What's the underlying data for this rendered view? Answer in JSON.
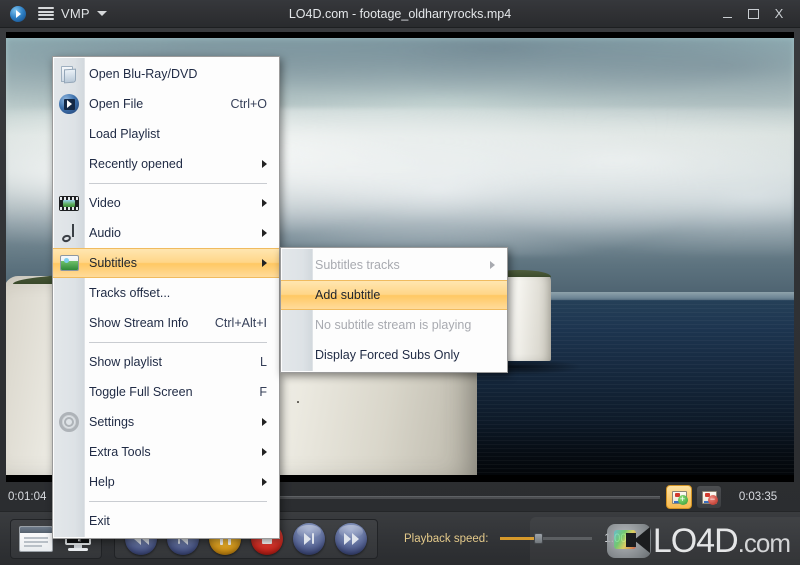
{
  "titlebar": {
    "app_name": "VMP",
    "title": "LO4D.com - footage_oldharryrocks.mp4",
    "minimize": "_",
    "maximize": "",
    "close": "X"
  },
  "menu": {
    "items": [
      {
        "label": "Open Blu-Ray/DVD",
        "accel": "",
        "icon": "folder-icon",
        "submenu": false,
        "disabled": false,
        "selected": false
      },
      {
        "label": "Open File",
        "accel": "Ctrl+O",
        "icon": "disc-play-icon",
        "submenu": false,
        "disabled": false,
        "selected": false
      },
      {
        "label": "Load Playlist",
        "accel": "",
        "icon": "",
        "submenu": false,
        "disabled": false,
        "selected": false
      },
      {
        "label": "Recently opened",
        "accel": "",
        "icon": "",
        "submenu": true,
        "disabled": false,
        "selected": false
      },
      {
        "separator": true
      },
      {
        "label": "Video",
        "accel": "",
        "icon": "film-icon",
        "submenu": true,
        "disabled": false,
        "selected": false
      },
      {
        "label": "Audio",
        "accel": "",
        "icon": "music-note-icon",
        "submenu": true,
        "disabled": false,
        "selected": false
      },
      {
        "label": "Subtitles",
        "accel": "",
        "icon": "subtitles-icon",
        "submenu": true,
        "disabled": false,
        "selected": true
      },
      {
        "label": "Tracks offset...",
        "accel": "",
        "icon": "",
        "submenu": false,
        "disabled": false,
        "selected": false
      },
      {
        "label": "Show Stream Info",
        "accel": "Ctrl+Alt+I",
        "icon": "",
        "submenu": false,
        "disabled": false,
        "selected": false
      },
      {
        "separator": true
      },
      {
        "label": "Show playlist",
        "accel": "L",
        "icon": "",
        "submenu": false,
        "disabled": false,
        "selected": false
      },
      {
        "label": "Toggle Full Screen",
        "accel": "F",
        "icon": "",
        "submenu": false,
        "disabled": false,
        "selected": false
      },
      {
        "label": "Settings",
        "accel": "",
        "icon": "gear-icon",
        "submenu": true,
        "disabled": false,
        "selected": false
      },
      {
        "label": "Extra Tools",
        "accel": "",
        "icon": "",
        "submenu": true,
        "disabled": false,
        "selected": false
      },
      {
        "label": "Help",
        "accel": "",
        "icon": "",
        "submenu": true,
        "disabled": false,
        "selected": false
      },
      {
        "separator": true
      },
      {
        "label": "Exit",
        "accel": "",
        "icon": "",
        "submenu": false,
        "disabled": false,
        "selected": false
      }
    ]
  },
  "submenu": {
    "items": [
      {
        "label": "Subtitles tracks",
        "submenu": true,
        "disabled": true,
        "selected": false
      },
      {
        "label": "Add subtitle",
        "submenu": false,
        "disabled": false,
        "selected": true
      },
      {
        "label": "No subtitle stream is playing",
        "submenu": false,
        "disabled": true,
        "selected": false
      },
      {
        "label": "Display Forced Subs Only",
        "submenu": false,
        "disabled": false,
        "selected": false
      }
    ]
  },
  "transport": {
    "current_time": "0:01:04",
    "total_time": "0:03:35",
    "add_subtitle_button": "subtitle-add-icon",
    "remove_subtitle_button": "subtitle-remove-icon",
    "playlist_button": "playlist-icon",
    "fullscreen_button": "fullscreen-icon",
    "buttons": [
      {
        "name": "rewind-button",
        "kind": "blue",
        "glyph": "rewind"
      },
      {
        "name": "previous-button",
        "kind": "blue",
        "glyph": "previous"
      },
      {
        "name": "pause-button",
        "kind": "yellow",
        "glyph": "pause"
      },
      {
        "name": "stop-button",
        "kind": "red",
        "glyph": "stop"
      },
      {
        "name": "next-button",
        "kind": "blue",
        "glyph": "next"
      },
      {
        "name": "forward-button",
        "kind": "blue",
        "glyph": "forward"
      }
    ],
    "speed_label": "Playback speed:",
    "speed_value": "1.00x"
  },
  "watermark": {
    "text": "LO4D",
    "suffix": ".com"
  },
  "colors": {
    "accent_highlight": "#ffc863",
    "window_chrome": "#303134",
    "menu_background": "#fdfdfd",
    "menu_text": "#1f2a44",
    "disabled_text": "#a8aab0",
    "stop_red": "#ef4338",
    "pause_yellow": "#f2b72f",
    "button_blue": "#6b7aa6"
  }
}
